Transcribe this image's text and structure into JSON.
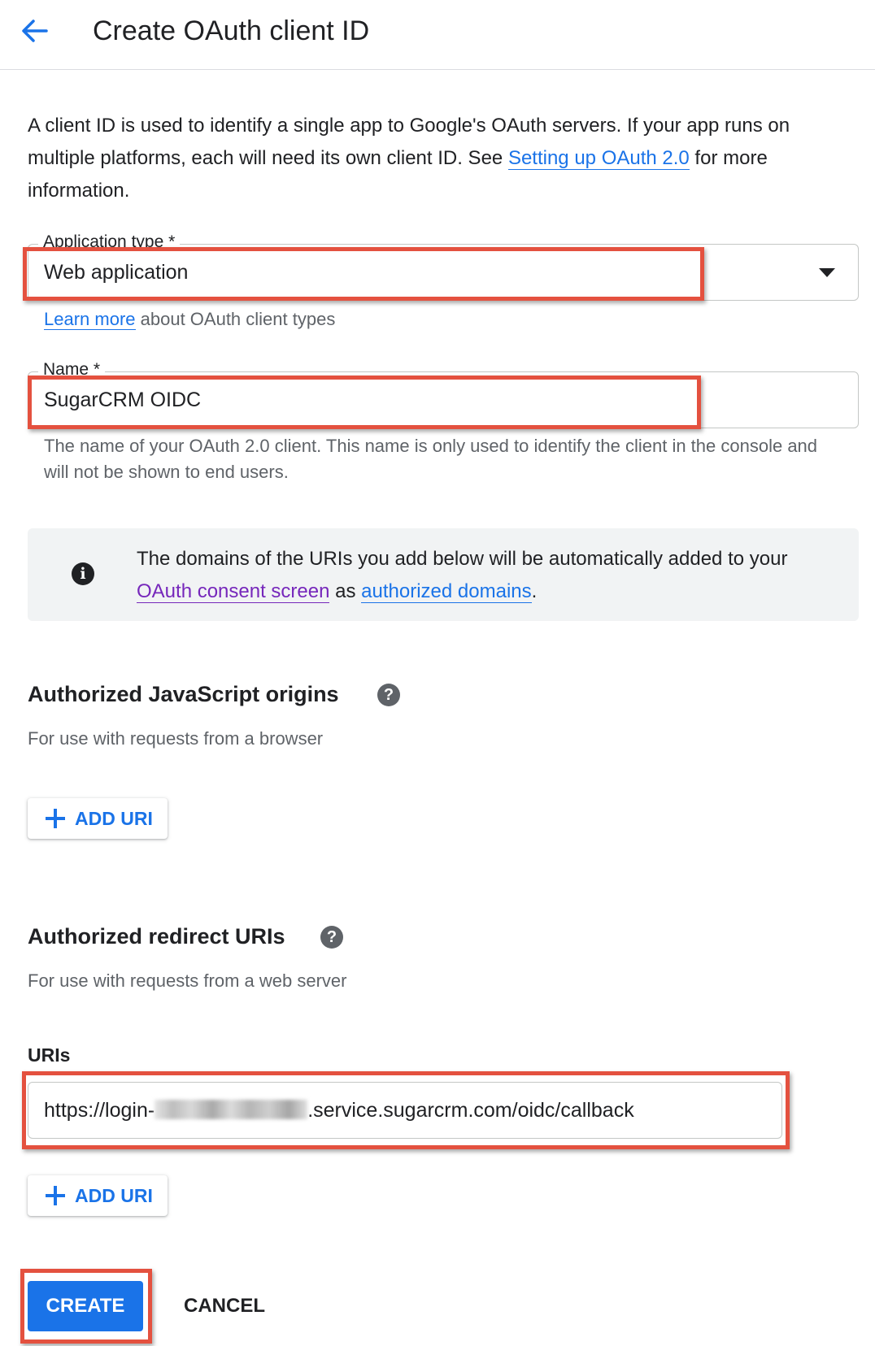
{
  "header": {
    "title": "Create OAuth client ID",
    "back_icon": "arrow-back-icon"
  },
  "intro": {
    "text_before": "A client ID is used to identify a single app to Google's OAuth servers. If your app runs on multiple platforms, each will need its own client ID. See ",
    "link": "Setting up OAuth 2.0",
    "text_after": " for more information."
  },
  "application_type": {
    "label": "Application type *",
    "value": "Web application",
    "helper_link": "Learn more",
    "helper_text": " about OAuth client types"
  },
  "name_field": {
    "label": "Name *",
    "value": "SugarCRM OIDC",
    "helper": "The name of your OAuth 2.0 client. This name is only used to identify the client in the console and will not be shown to end users."
  },
  "info_banner": {
    "icon": "info-icon",
    "text_before": "The domains of the URIs you add below will be automatically added to your ",
    "link_consent": "OAuth consent screen",
    "text_middle": " as ",
    "link_domains": "authorized domains",
    "text_after": "."
  },
  "js_origins": {
    "title": "Authorized JavaScript origins",
    "subtitle": "For use with requests from a browser",
    "add_label": "ADD URI"
  },
  "redirect_uris": {
    "title": "Authorized redirect URIs",
    "subtitle": "For use with requests from a web server",
    "uris_label": "URIs",
    "uri_prefix": "https://login-",
    "uri_suffix": ".service.sugarcrm.com/oidc/callback",
    "add_label": "ADD URI"
  },
  "actions": {
    "create": "CREATE",
    "cancel": "CANCEL"
  },
  "colors": {
    "primary": "#1a73e8",
    "visited_link": "#7627bb",
    "highlight": "#e4513f",
    "banner_bg": "#f1f3f4"
  }
}
